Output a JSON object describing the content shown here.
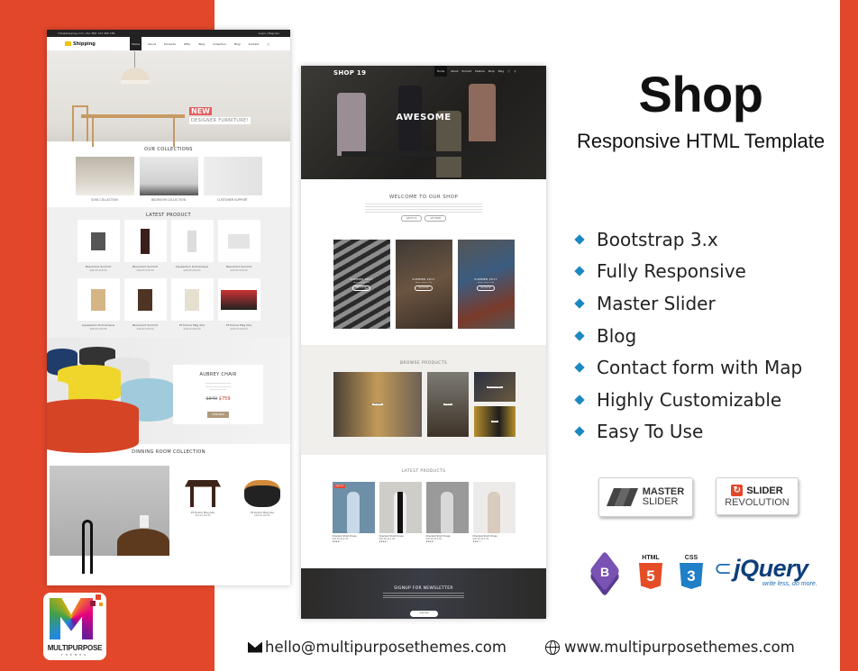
{
  "banner": {
    "title": "Shop",
    "subtitle": "Responsive HTML Template",
    "brand_color": "#e2472a",
    "bullet_color": "#1b88c2",
    "features": [
      "Bootstrap 3.x",
      "Fully Responsive",
      "Master Slider",
      "Blog",
      "Contact form with Map",
      "Highly Customizable",
      "Easy To Use"
    ],
    "badges": {
      "master_slider": {
        "line1": "MASTER",
        "line2": "SLIDER"
      },
      "slider_revolution": {
        "line1": "SLIDER",
        "line2": "REVOLUTION"
      }
    },
    "tech_logos": {
      "bootstrap": "B",
      "html5_label": "HTML",
      "html5_num": "5",
      "css3_label": "CSS",
      "css3_num": "3",
      "jquery_word": "jQuery",
      "jquery_tagline": "write less, do more."
    },
    "vendor_logo": {
      "name": "MULTIPURPOSE",
      "sub": "THEMES"
    },
    "contact": {
      "email": "hello@multipurposethemes.com",
      "website": "www.multipurposethemes.com"
    }
  },
  "mockup_furniture": {
    "topbar_left": "info@shipping.com | Tel: 800 123 456 789",
    "topbar_right": "Login | Register",
    "logo": "Shipping",
    "nav": [
      "Home",
      "About",
      "Products",
      "Offer",
      "Blog",
      "Collection",
      "Blog",
      "Contact"
    ],
    "hero": {
      "badge": "NEW",
      "tagline": "DESIGNER FURNITURE!"
    },
    "collections_title": "OUR COLLECTIONS",
    "collections": [
      "SOFA COLLECTION",
      "BEDROOM COLLECTION",
      "CUSTOMER SUPPORT"
    ],
    "latest_title": "LATEST PRODUCT",
    "products": [
      {
        "name": "Beaumont Summit",
        "price": "$49.00  $39.00"
      },
      {
        "name": "Beaumont Summit",
        "price": "$49.00  $39.00"
      },
      {
        "name": "Aquaestum Doloremque",
        "price": "$49.00  $39.00"
      },
      {
        "name": "Beaumont Summit",
        "price": "$49.00  $39.00"
      },
      {
        "name": "Aquaestum Doloremque",
        "price": "$49.00  $39.00"
      },
      {
        "name": "Beaumont Summit",
        "price": "$49.00  $39.00"
      },
      {
        "name": "Et Dolore Mag Aliq",
        "price": "$49.00  $39.00"
      },
      {
        "name": "Et Dolore Mag Aliq",
        "price": "$49.00  $39.00"
      }
    ],
    "feature_product": {
      "title": "AUBREY CHAIR",
      "old_price": "$949",
      "price": "$759",
      "button": "SHOP NOW"
    },
    "dining_title": "DINNING ROOM COLLECTION",
    "dining_products": [
      {
        "name": "Et Dolore Mag Aliq",
        "price": "$49.00  $39.00"
      },
      {
        "name": "Et Dolore Mag Aliq",
        "price": "$49.00  $39.00"
      }
    ]
  },
  "mockup_fashion": {
    "logo": "SHOP 19",
    "nav": [
      "Home",
      "About",
      "Product",
      "Feature",
      "Shop",
      "Blog"
    ],
    "hero_title": "AWESOME",
    "welcome_title": "WELCOME TO OUR SHOP",
    "welcome_buttons": [
      "ABOUT US",
      "GET MORE"
    ],
    "promo_cards": [
      {
        "title": "SUMMER 2017",
        "sub": "NEW COLLECTION",
        "button": "SHOP NOW"
      },
      {
        "title": "SUMMER 2017",
        "sub": "NEW COLLECTION",
        "button": "SHOP NOW"
      },
      {
        "title": "SUMMER 2017",
        "sub": "NEW COLLECTION",
        "button": "SHOP NOW"
      }
    ],
    "browse_title": "BROWSE PRODUCTS",
    "browse_tiles": [
      "WOMEN",
      "DRESS",
      "ACCESSORIES",
      "MEN"
    ],
    "latest_title": "LATEST PRODUCTS",
    "latest_products": [
      {
        "name": "Checked Short Dress",
        "price": "$40.00  $12.49",
        "rating": "★★★★☆",
        "sale": "SALE OFF"
      },
      {
        "name": "Checked Short Dress",
        "price": "$40.00  $12.49",
        "rating": "★★★★☆",
        "sale": ""
      },
      {
        "name": "Checked Short Dress",
        "price": "$40.00  $12.49",
        "rating": "★★★★☆",
        "sale": ""
      },
      {
        "name": "Checked Short Dress",
        "price": "$40.00  $12.49",
        "rating": "★★★☆☆",
        "sale": ""
      }
    ],
    "newsletter_title": "SIGNUP FOR NEWSLETTER",
    "newsletter_button": "SUBSCRIBE"
  }
}
